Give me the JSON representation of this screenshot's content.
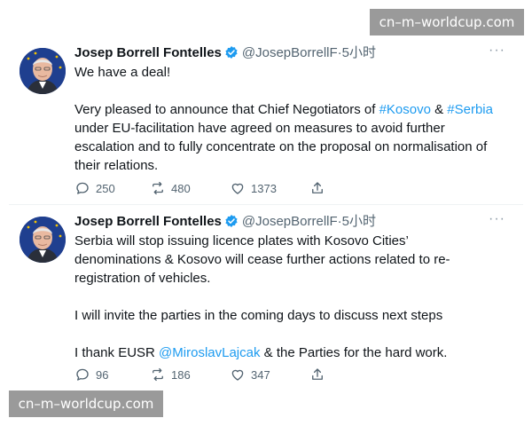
{
  "watermark": {
    "top": "cn–m–worldcup.com",
    "bottom": "cn–m–worldcup.com"
  },
  "tweets": [
    {
      "author_name": "Josep Borrell Fontelles",
      "handle": "@JosepBorrellF",
      "separator": "·",
      "time": "5小时",
      "more": "···",
      "lines": [
        "We have a deal!",
        "",
        "Very pleased to announce that Chief Negotiators of ",
        "under EU-facilitation have agreed on measures to avoid further",
        "escalation and to fully concentrate on the proposal on normalisation of",
        "their relations."
      ],
      "hashtag_kosovo": "#Kosovo",
      "amp": " & ",
      "hashtag_serbia": "#Serbia",
      "replies": "250",
      "retweets": "480",
      "likes": "1373"
    },
    {
      "author_name": "Josep Borrell Fontelles",
      "handle": "@JosepBorrellF",
      "separator": "·",
      "time": "5小时",
      "more": "···",
      "lines": [
        "Serbia will stop issuing licence plates with Kosovo Cities’",
        "denominations & Kosovo will cease further actions related to re-",
        "registration of vehicles.",
        "",
        "I will invite the parties in the coming days to discuss next steps",
        ""
      ],
      "last_prefix": "I thank EUSR ",
      "mention": "@MiroslavLajcak",
      "last_suffix": " & the Parties for the hard work.",
      "replies": "96",
      "retweets": "186",
      "likes": "347"
    }
  ]
}
